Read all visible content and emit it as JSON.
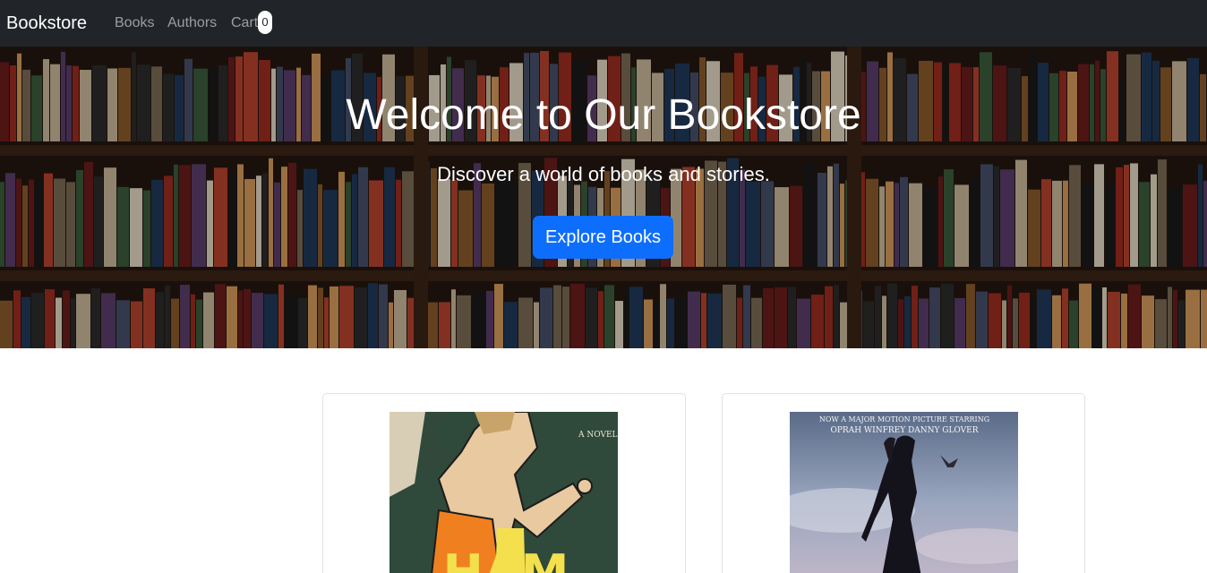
{
  "navbar": {
    "brand": "Bookstore",
    "links": [
      "Books",
      "Authors",
      "Cart"
    ],
    "cart_count": "0"
  },
  "hero": {
    "title": "Welcome to Our Bookstore",
    "subtitle": "Discover a world of books and stories.",
    "button": "Explore Books"
  },
  "books": [
    {
      "cover_tag": "A NOVEL",
      "cover_title": "HAM"
    },
    {
      "cover_line1": "NOW A MAJOR MOTION PICTURE STARRING",
      "cover_line2": "OPRAH WINFREY     DANNY GLOVER"
    }
  ],
  "colors": {
    "navbar_bg": "#212529",
    "primary": "#0d6efd",
    "card_border": "#dfe1e4"
  }
}
